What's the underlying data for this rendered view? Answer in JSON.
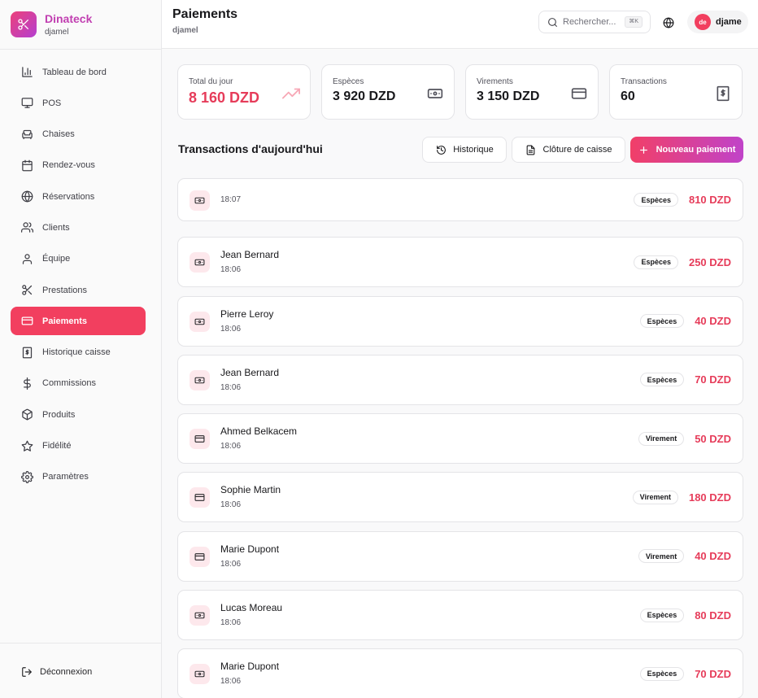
{
  "brand": {
    "name": "Dinateck",
    "subtitle": "djamel"
  },
  "nav": [
    {
      "label": "Tableau de bord",
      "icon": "bar-chart-icon",
      "active": false
    },
    {
      "label": "POS",
      "icon": "monitor-icon",
      "active": false
    },
    {
      "label": "Chaises",
      "icon": "chair-icon",
      "active": false
    },
    {
      "label": "Rendez-vous",
      "icon": "calendar-icon",
      "active": false
    },
    {
      "label": "Réservations",
      "icon": "globe-icon",
      "active": false
    },
    {
      "label": "Clients",
      "icon": "users-icon",
      "active": false
    },
    {
      "label": "Équipe",
      "icon": "user-icon",
      "active": false
    },
    {
      "label": "Prestations",
      "icon": "scissors-icon",
      "active": false
    },
    {
      "label": "Paiements",
      "icon": "credit-card-icon",
      "active": true
    },
    {
      "label": "Historique caisse",
      "icon": "receipt-icon",
      "active": false
    },
    {
      "label": "Commissions",
      "icon": "dollar-icon",
      "active": false
    },
    {
      "label": "Produits",
      "icon": "package-icon",
      "active": false
    },
    {
      "label": "Fidélité",
      "icon": "star-icon",
      "active": false
    },
    {
      "label": "Paramètres",
      "icon": "gear-icon",
      "active": false
    }
  ],
  "logout": {
    "label": "Déconnexion"
  },
  "header": {
    "title": "Paiements",
    "subtitle": "djamel",
    "search_placeholder": "Rechercher...",
    "search_shortcut": "⌘K",
    "user_initials": "de",
    "user_name": "djame"
  },
  "stats": [
    {
      "label": "Total du jour",
      "value": "8 160 DZD",
      "icon": "trending-up-icon",
      "accent": true
    },
    {
      "label": "Espèces",
      "value": "3 920 DZD",
      "icon": "banknote-icon",
      "accent": false
    },
    {
      "label": "Virements",
      "value": "3 150 DZD",
      "icon": "credit-card-icon",
      "accent": false
    },
    {
      "label": "Transactions",
      "value": "60",
      "icon": "receipt-icon",
      "accent": false
    }
  ],
  "section": {
    "title": "Transactions d'aujourd'hui",
    "history_label": "Historique",
    "close_label": "Clôture de caisse",
    "new_label": "Nouveau paiement"
  },
  "transactions": [
    {
      "name": "",
      "time": "18:07",
      "method": "Espèces",
      "amount": "810 DZD",
      "icon": "banknote-icon"
    },
    {
      "name": "Jean Bernard",
      "time": "18:06",
      "method": "Espèces",
      "amount": "250 DZD",
      "icon": "banknote-icon"
    },
    {
      "name": "Pierre Leroy",
      "time": "18:06",
      "method": "Espèces",
      "amount": "40 DZD",
      "icon": "banknote-icon"
    },
    {
      "name": "Jean Bernard",
      "time": "18:06",
      "method": "Espèces",
      "amount": "70 DZD",
      "icon": "banknote-icon"
    },
    {
      "name": "Ahmed Belkacem",
      "time": "18:06",
      "method": "Virement",
      "amount": "50 DZD",
      "icon": "credit-card-icon"
    },
    {
      "name": "Sophie Martin",
      "time": "18:06",
      "method": "Virement",
      "amount": "180 DZD",
      "icon": "credit-card-icon"
    },
    {
      "name": "Marie Dupont",
      "time": "18:06",
      "method": "Virement",
      "amount": "40 DZD",
      "icon": "credit-card-icon"
    },
    {
      "name": "Lucas Moreau",
      "time": "18:06",
      "method": "Espèces",
      "amount": "80 DZD",
      "icon": "banknote-icon"
    },
    {
      "name": "Marie Dupont",
      "time": "18:06",
      "method": "Espèces",
      "amount": "70 DZD",
      "icon": "banknote-icon"
    }
  ],
  "colors": {
    "accent": "#f23f5f",
    "amount": "#e63c5a",
    "brand_gradient_start": "#ec407a",
    "brand_gradient_end": "#b43fd1"
  }
}
